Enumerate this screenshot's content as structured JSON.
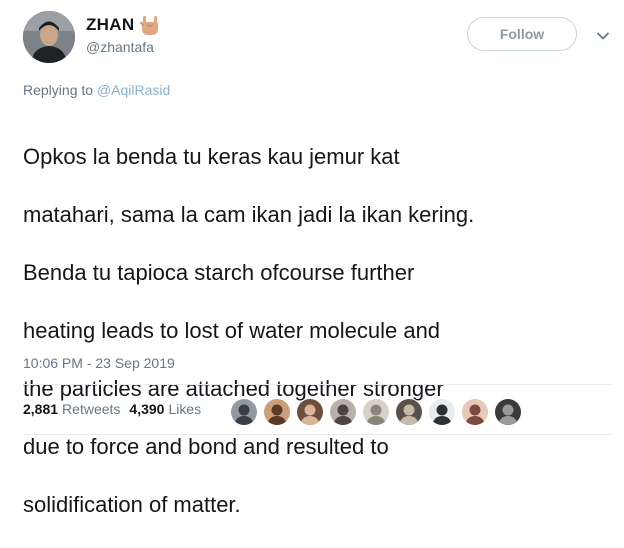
{
  "tweet": {
    "display_name": "ZHAN",
    "name_emoji_icon": "rock-on-hand-icon",
    "handle": "@zhantafa",
    "follow_label": "Follow",
    "replying_prefix": "Replying to ",
    "replying_to": "@AqilRasid",
    "text_lines": [
      "Opkos la benda tu keras kau jemur kat",
      "matahari, sama la cam ikan jadi la ikan kering.",
      "Benda tu tapioca starch ofcourse further",
      "heating leads to lost of water molecule and",
      "the particles are attached together stronger",
      "due to force and bond and resulted to",
      "solidification of matter."
    ],
    "timestamp": "10:06 PM - 23 Sep 2019",
    "retweets_count": "2,881",
    "retweets_label": "Retweets",
    "likes_count": "4,390",
    "likes_label": "Likes"
  },
  "colors": {
    "text": "#14171a",
    "muted": "#657786",
    "mention": "#8ab3cf",
    "follow_border": "#c8d3da",
    "divider": "#e6ecf0"
  },
  "likers": [
    {
      "icon": "liker-avatar-1",
      "bg": "#8f9aa3",
      "fg": "#3b3f44"
    },
    {
      "icon": "liker-avatar-2",
      "bg": "#c9a07a",
      "fg": "#5b3a2a"
    },
    {
      "icon": "liker-avatar-3",
      "bg": "#6e4e3c",
      "fg": "#d9b59a"
    },
    {
      "icon": "liker-avatar-4",
      "bg": "#b8b0aa",
      "fg": "#4d4440"
    },
    {
      "icon": "liker-avatar-5",
      "bg": "#d7d2c9",
      "fg": "#8c8378"
    },
    {
      "icon": "liker-avatar-6",
      "bg": "#59524c",
      "fg": "#c7b9a8"
    },
    {
      "icon": "liker-avatar-7",
      "bg": "#e9ecef",
      "fg": "#2c3136"
    },
    {
      "icon": "liker-avatar-8",
      "bg": "#e8c6b8",
      "fg": "#7a4b3c"
    },
    {
      "icon": "liker-avatar-9",
      "bg": "#3a3a3a",
      "fg": "#9a9a9a"
    }
  ]
}
